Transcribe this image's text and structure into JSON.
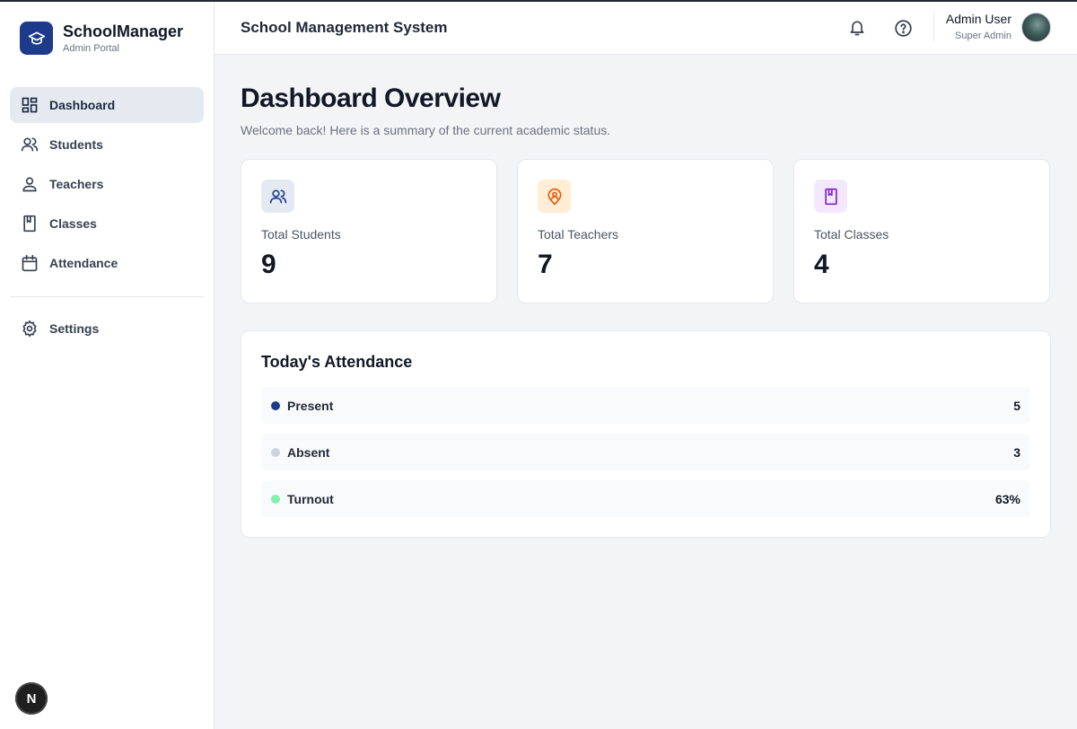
{
  "brand": {
    "name": "SchoolManager",
    "subtitle": "Admin Portal"
  },
  "sidebar": {
    "items": [
      {
        "label": "Dashboard",
        "icon": "dashboard-icon",
        "active": true
      },
      {
        "label": "Students",
        "icon": "students-icon",
        "active": false
      },
      {
        "label": "Teachers",
        "icon": "teacher-icon",
        "active": false
      },
      {
        "label": "Classes",
        "icon": "book-icon",
        "active": false
      },
      {
        "label": "Attendance",
        "icon": "calendar-icon",
        "active": false
      }
    ],
    "settings_label": "Settings",
    "fab_label": "N"
  },
  "header": {
    "title": "School Management System",
    "user_name": "Admin User",
    "user_role": "Super Admin"
  },
  "page": {
    "title": "Dashboard Overview",
    "subtitle": "Welcome back! Here is a summary of the current academic status."
  },
  "stats": [
    {
      "label": "Total Students",
      "value": "9",
      "icon": "students-icon",
      "color": "#1e3a8a",
      "bg": "#e5e9f2"
    },
    {
      "label": "Total Teachers",
      "value": "7",
      "icon": "teacher-badge-icon",
      "color": "#ea580c",
      "bg": "#ffedd5"
    },
    {
      "label": "Total Classes",
      "value": "4",
      "icon": "book-icon",
      "color": "#7e22ce",
      "bg": "#f3e8ff"
    }
  ],
  "attendance": {
    "title": "Today's Attendance",
    "rows": [
      {
        "label": "Present",
        "value": "5",
        "color": "#1e3a8a"
      },
      {
        "label": "Absent",
        "value": "3",
        "color": "#cbd5e1"
      },
      {
        "label": "Turnout",
        "value": "63%",
        "color": "#86efac"
      }
    ]
  }
}
